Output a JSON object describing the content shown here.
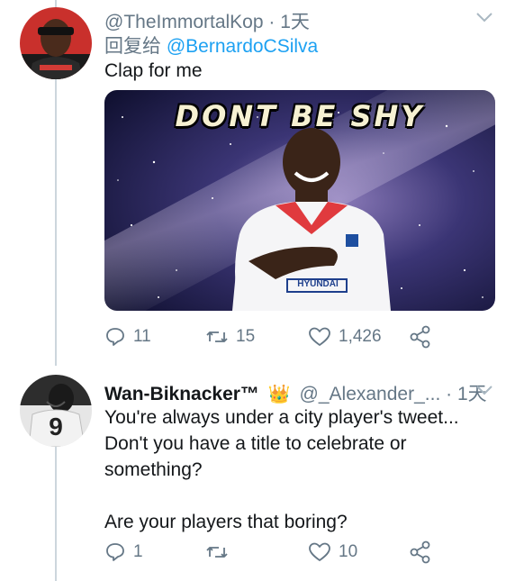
{
  "tweet1": {
    "handle": "@TheImmortalKop",
    "time": "· 1天",
    "reply_prefix": "回复给",
    "reply_to": "@BernardoCSilva",
    "text": "Clap for me",
    "media_caption": "DONT BE SHY",
    "shirt_text": "HYUNDAI",
    "counts": {
      "replies": "11",
      "retweets": "15",
      "likes": "1,426"
    }
  },
  "tweet2": {
    "name": "Wan-Biknacker™",
    "handle": "@_Alexander_...",
    "time": "· 1天",
    "text": "You're always under a city player's tweet...\nDon't you have a title to celebrate or\nsomething?\n\nAre your players that boring?",
    "avatar_number": "9",
    "counts": {
      "replies": "1",
      "retweets": "",
      "likes": "10"
    }
  },
  "colors": {
    "link": "#1da1f2",
    "meta": "#657786",
    "thread_line": "#ccd6dd"
  }
}
